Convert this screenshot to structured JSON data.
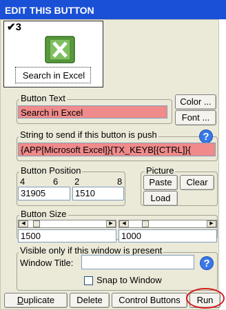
{
  "title": "EDIT THIS BUTTON",
  "preview": {
    "check_label": "✔3",
    "caption": "Search in Excel",
    "icon": "excel-icon"
  },
  "button_text": {
    "legend": "Button Text",
    "value": "Search in Excel",
    "color_label": "Color ...",
    "font_label": "Font ..."
  },
  "send_string": {
    "legend": "String to send if this button is push",
    "value": "{APP[Microsoft Excel]}{TX_KEYB[{CTRL]}{",
    "help": "?"
  },
  "position": {
    "legend": "Button Position",
    "tick_4": "4",
    "tick_6": "6",
    "tick_2": "2",
    "tick_8": "8",
    "x_value": "31905",
    "y_value": "1510"
  },
  "picture": {
    "legend": "Picture",
    "paste_label": "Paste",
    "clear_label": "Clear",
    "load_label": "Load"
  },
  "size": {
    "legend": "Button Size",
    "width_value": "1500",
    "height_value": "1000"
  },
  "visible": {
    "legend": "Visible only if this window is present",
    "window_title_label": "Window Title:",
    "window_title_value": "",
    "snap_label": "Snap to Window",
    "help": "?"
  },
  "actions": {
    "duplicate_prefix": "D",
    "duplicate_rest": "uplicate",
    "delete_label": "Delete",
    "control_label": "Control Buttons",
    "run_label": "Run"
  },
  "colors": {
    "title_bar": "#1a50d6",
    "panel": "#ebe9d8",
    "text_field_red": "#f08b8b",
    "run_highlight": "#d31b1b"
  }
}
